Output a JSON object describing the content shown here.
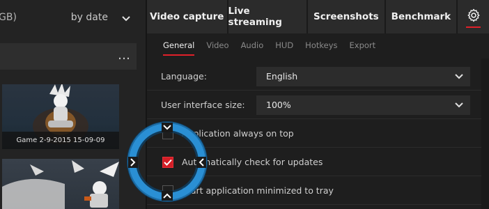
{
  "left": {
    "storage_text": "GB)",
    "sort_label": "by date",
    "more_label": "…",
    "thumbnails": [
      {
        "caption": "Game 2-9-2015 15-09-09"
      },
      {
        "caption": ""
      }
    ]
  },
  "tabs": [
    {
      "label": "Video capture"
    },
    {
      "label": "Live streaming"
    },
    {
      "label": "Screenshots"
    },
    {
      "label": "Benchmark"
    }
  ],
  "subtabs": [
    {
      "label": "General",
      "active": true
    },
    {
      "label": "Video"
    },
    {
      "label": "Audio"
    },
    {
      "label": "HUD"
    },
    {
      "label": "Hotkeys"
    },
    {
      "label": "Export"
    }
  ],
  "settings": {
    "language": {
      "label": "Language:",
      "value": "English"
    },
    "ui_size": {
      "label": "User interface size:",
      "value": "100%"
    },
    "always_on_top": {
      "label": "Application always on top",
      "checked": false
    },
    "check_updates": {
      "label": "Automatically check for updates",
      "checked": true
    },
    "minimized": {
      "label": "Start application minimized to tray",
      "checked": false
    }
  },
  "colors": {
    "accent": "#e0202a",
    "ring": "#2a8fd4"
  }
}
